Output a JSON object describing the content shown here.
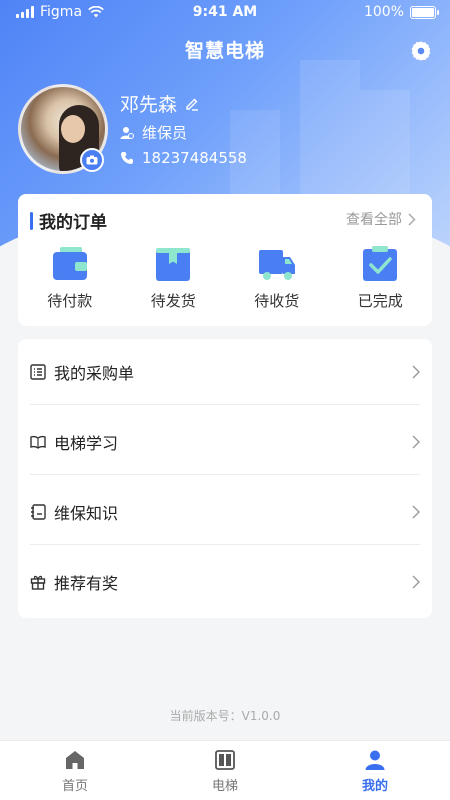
{
  "status_bar": {
    "carrier": "Figma",
    "time": "9:41 AM",
    "battery": "100%"
  },
  "header": {
    "title": "智慧电梯",
    "settings_icon": "gear-icon"
  },
  "profile": {
    "name": "邓先森",
    "role": "维保员",
    "phone": "18237484558"
  },
  "orders": {
    "title": "我的订单",
    "view_all": "查看全部",
    "items": [
      {
        "label": "待付款",
        "icon": "wallet-icon"
      },
      {
        "label": "待发货",
        "icon": "box-icon"
      },
      {
        "label": "待收货",
        "icon": "truck-icon"
      },
      {
        "label": "已完成",
        "icon": "clipboard-check-icon"
      }
    ]
  },
  "menu": {
    "items": [
      {
        "label": "我的采购单",
        "icon": "list-icon"
      },
      {
        "label": "电梯学习",
        "icon": "book-icon"
      },
      {
        "label": "维保知识",
        "icon": "notebook-icon"
      },
      {
        "label": "推荐有奖",
        "icon": "gift-icon"
      }
    ]
  },
  "version": "当前版本号：V1.0.0",
  "tabbar": {
    "active": "我的",
    "items": [
      {
        "label": "首页",
        "icon": "home-icon"
      },
      {
        "label": "电梯",
        "icon": "elevator-icon"
      },
      {
        "label": "我的",
        "icon": "user-icon"
      }
    ]
  },
  "colors": {
    "accent": "#3a6ff0",
    "icon_blue": "#4a7ff3",
    "icon_mint": "#8ee6cf"
  }
}
